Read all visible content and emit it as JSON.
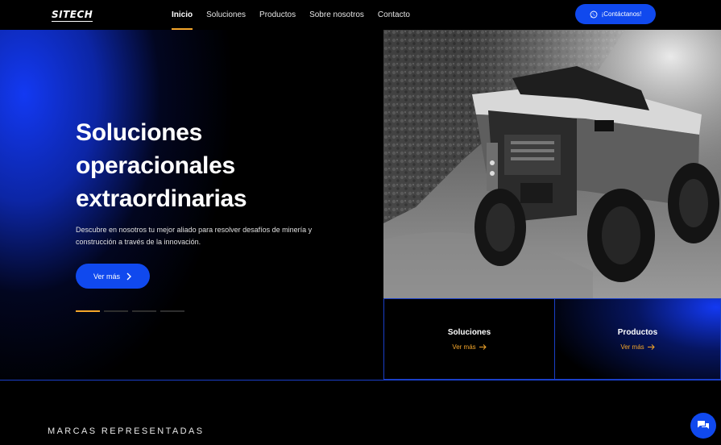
{
  "nav": {
    "logo": "SITECH",
    "items": [
      {
        "label": "Inicio",
        "active": true
      },
      {
        "label": "Soluciones",
        "active": false
      },
      {
        "label": "Productos",
        "active": false
      },
      {
        "label": "Sobre nosotros",
        "active": false
      },
      {
        "label": "Contacto",
        "active": false
      }
    ],
    "cta_label": "¡Contáctanos!",
    "cta_icon": "whatsapp-icon"
  },
  "hero": {
    "title": "Soluciones operacionales extraordinarias",
    "description": "Descubre en nosotros tu mejor aliado para resolver desafíos de minería y construcción a través de la innovación.",
    "button_label": "Ver más",
    "slides_total": 4,
    "slide_active": 1,
    "image": "mining-haul-truck"
  },
  "cards": [
    {
      "title": "Soluciones",
      "link": "Ver más"
    },
    {
      "title": "Productos",
      "link": "Ver más"
    }
  ],
  "brands_heading": "MARCAS REPRESENTADAS",
  "colors": {
    "accent": "#1049ee",
    "highlight": "#f4a62a",
    "background": "#000000"
  },
  "chat_icon": "chat-bubbles-icon"
}
